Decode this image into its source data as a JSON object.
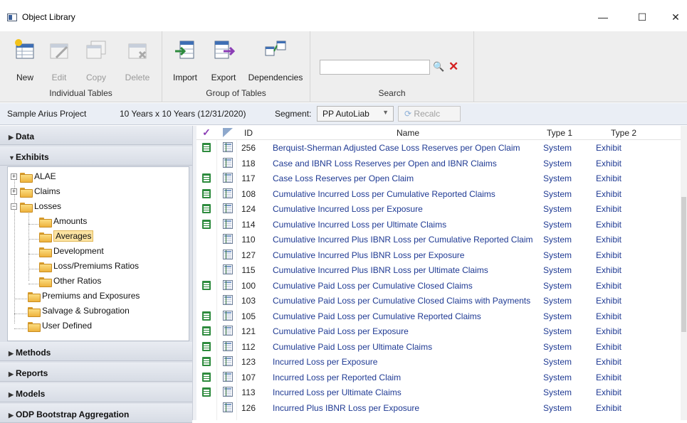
{
  "window": {
    "title": "Object Library",
    "minimize": "—",
    "maximize": "☐",
    "close": "✕"
  },
  "ribbon": {
    "individual": {
      "label": "Individual Tables",
      "new": "New",
      "edit": "Edit",
      "copy": "Copy",
      "delete": "Delete"
    },
    "group": {
      "label": "Group of Tables",
      "import": "Import",
      "export": "Export",
      "dependencies": "Dependencies"
    },
    "search": {
      "label": "Search",
      "value": "",
      "search_icon": "🔍",
      "clear_icon": "✕"
    }
  },
  "project": {
    "name": "Sample Arius Project",
    "period": "10 Years x 10 Years (12/31/2020)",
    "segment_label": "Segment:",
    "segment_value": "PP AutoLiab",
    "recalc": "Recalc"
  },
  "sidebar": {
    "sections": [
      "Data",
      "Exhibits",
      "Methods",
      "Reports",
      "Models",
      "ODP Bootstrap Aggregation"
    ],
    "tree": {
      "alae": "ALAE",
      "claims": "Claims",
      "losses": "Losses",
      "amounts": "Amounts",
      "averages": "Averages",
      "development": "Development",
      "loss_premiums": "Loss/Premiums Ratios",
      "other_ratios": "Other Ratios",
      "premiums": "Premiums and Exposures",
      "salvage": "Salvage & Subrogation",
      "user_defined": "User Defined"
    }
  },
  "grid": {
    "headers": {
      "check": "✓",
      "id": "ID",
      "name": "Name",
      "type1": "Type 1",
      "type2": "Type 2"
    },
    "rows": [
      {
        "xl": true,
        "id": "256",
        "name": "Berquist-Sherman Adjusted Case Loss Reserves per Open Claim",
        "type1": "System",
        "type2": "Exhibit"
      },
      {
        "xl": false,
        "id": "118",
        "name": "Case and IBNR Loss Reserves per Open and IBNR Claims",
        "type1": "System",
        "type2": "Exhibit"
      },
      {
        "xl": true,
        "id": "117",
        "name": "Case Loss Reserves per Open Claim",
        "type1": "System",
        "type2": "Exhibit"
      },
      {
        "xl": true,
        "id": "108",
        "name": "Cumulative Incurred Loss per Cumulative Reported Claims",
        "type1": "System",
        "type2": "Exhibit"
      },
      {
        "xl": true,
        "id": "124",
        "name": "Cumulative Incurred Loss per Exposure",
        "type1": "System",
        "type2": "Exhibit"
      },
      {
        "xl": true,
        "id": "114",
        "name": "Cumulative Incurred Loss per Ultimate Claims",
        "type1": "System",
        "type2": "Exhibit"
      },
      {
        "xl": false,
        "id": "110",
        "name": "Cumulative Incurred Plus IBNR Loss per Cumulative Reported Claim",
        "type1": "System",
        "type2": "Exhibit"
      },
      {
        "xl": false,
        "id": "127",
        "name": "Cumulative Incurred Plus IBNR Loss per Exposure",
        "type1": "System",
        "type2": "Exhibit"
      },
      {
        "xl": false,
        "id": "115",
        "name": "Cumulative Incurred Plus IBNR Loss per Ultimate Claims",
        "type1": "System",
        "type2": "Exhibit"
      },
      {
        "xl": true,
        "id": "100",
        "name": "Cumulative Paid Loss per Cumulative Closed Claims",
        "type1": "System",
        "type2": "Exhibit"
      },
      {
        "xl": false,
        "id": "103",
        "name": "Cumulative Paid Loss per Cumulative Closed Claims with Payments",
        "type1": "System",
        "type2": "Exhibit"
      },
      {
        "xl": true,
        "id": "105",
        "name": "Cumulative Paid Loss per Cumulative Reported Claims",
        "type1": "System",
        "type2": "Exhibit"
      },
      {
        "xl": true,
        "id": "121",
        "name": "Cumulative Paid Loss per Exposure",
        "type1": "System",
        "type2": "Exhibit"
      },
      {
        "xl": true,
        "id": "112",
        "name": "Cumulative Paid Loss per Ultimate Claims",
        "type1": "System",
        "type2": "Exhibit"
      },
      {
        "xl": true,
        "id": "123",
        "name": "Incurred Loss per Exposure",
        "type1": "System",
        "type2": "Exhibit"
      },
      {
        "xl": true,
        "id": "107",
        "name": "Incurred Loss per Reported Claim",
        "type1": "System",
        "type2": "Exhibit"
      },
      {
        "xl": true,
        "id": "113",
        "name": "Incurred Loss per Ultimate Claims",
        "type1": "System",
        "type2": "Exhibit"
      },
      {
        "xl": false,
        "id": "126",
        "name": "Incurred Plus IBNR Loss per Exposure",
        "type1": "System",
        "type2": "Exhibit"
      }
    ]
  },
  "colors": {
    "accent": "#1f3a93",
    "excel_green": "#2e8b3e",
    "selected": "#fbe3a2"
  }
}
